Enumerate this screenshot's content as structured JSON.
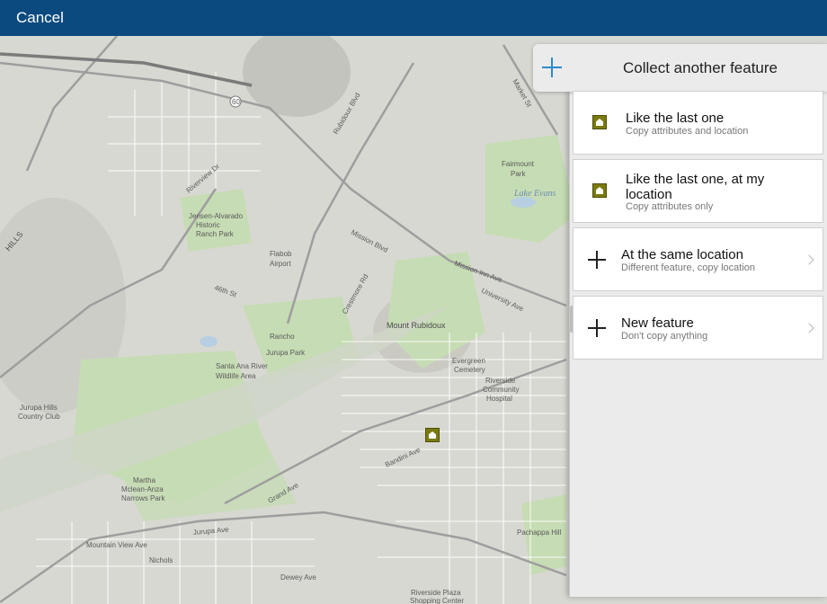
{
  "topbar": {
    "cancel_label": "Cancel"
  },
  "panel": {
    "title": "Collect another feature",
    "options": [
      {
        "title": "Like the last one",
        "subtitle": "Copy attributes and location",
        "icon": "feature-house-icon"
      },
      {
        "title": "Like the last one, at my location",
        "subtitle": "Copy attributes only",
        "icon": "feature-house-icon"
      },
      {
        "title": "At the same location",
        "subtitle": "Different feature, copy location",
        "icon": "plus-icon"
      },
      {
        "title": "New feature",
        "subtitle": "Don't copy anything",
        "icon": "plus-icon"
      }
    ]
  },
  "map": {
    "labels": {
      "mission_blvd": "Mission Blvd",
      "mission_inn": "Mission Inn Ave",
      "rubidoux_blvd": "Rubidoux Blvd",
      "jurupa_ave": "Jurupa Ave",
      "grand_ave": "Grand Ave",
      "flabob": "Flabob",
      "airport": "Airport",
      "mount_rubidoux": "Mount Rubidoux",
      "santa_ana": "Santa Ana River",
      "wildlife": "Wildlife Area",
      "evergreen": "Evergreen",
      "cemetery": "Cemetery",
      "fairmount": "Fairmount",
      "park": "Park",
      "lake_evans": "Lake Evans",
      "jurupa_hills": "Jurupa Hills",
      "country_club": "Country Club",
      "martha": "Martha",
      "mclean": "Mclean-Anza",
      "narrows": "Narrows Park",
      "rancho": "Rancho",
      "jurupa_park": "Jurupa Park",
      "riverside": "Riverside",
      "community": "Community",
      "hospital": "Hospital",
      "mountain_view": "Mountain View Ave",
      "pachappa": "Pachappa Hill",
      "nichols": "Nichols",
      "dewey": "Dewey Ave",
      "bandini": "Bandini Ave",
      "market_st": "Market St",
      "hills": "HILLS",
      "hwy60": "60",
      "jensen": "Jensen-Alvarado",
      "historic": "Historic",
      "ranch": "Ranch Park",
      "riverview": "Riverview Dr",
      "crestmore": "Crestmore Rd",
      "46th": "46th St",
      "university": "University Ave",
      "riverside_plaza": "Riverside Plaza",
      "shopping": "Shopping Center"
    },
    "colors": {
      "park": "#c6dcb4",
      "road": "#ffffff",
      "highway": "#b9b9b9",
      "accent": "#0b4a7e"
    }
  }
}
